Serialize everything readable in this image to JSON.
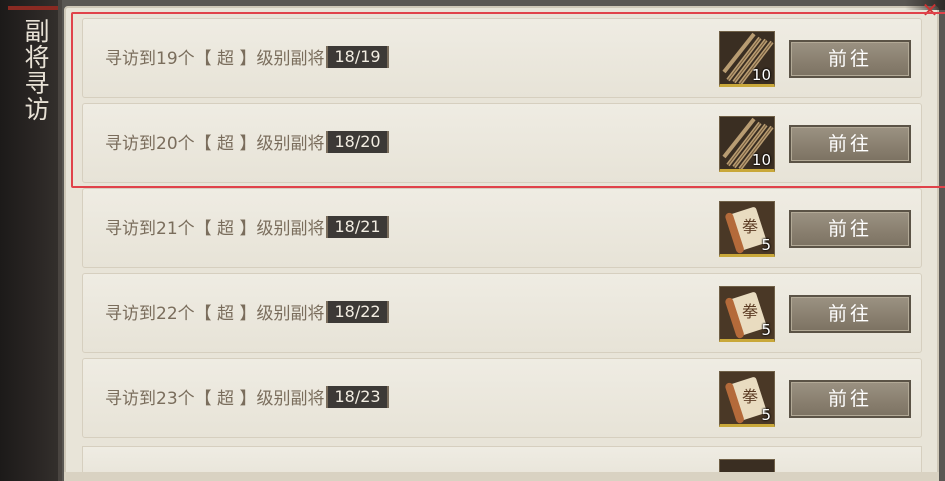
{
  "side_tab": {
    "title": "副将寻访"
  },
  "rows": [
    {
      "text": "寻访到19个【 超 】级别副将",
      "progress": "18/19",
      "reward_type": "bamboo-slips-icon",
      "reward_count": "10",
      "button": "前往"
    },
    {
      "text": "寻访到20个【 超 】级别副将",
      "progress": "18/20",
      "reward_type": "bamboo-slips-icon",
      "reward_count": "10",
      "button": "前往"
    },
    {
      "text": "寻访到21个【 超 】级别副将",
      "progress": "18/21",
      "reward_type": "scroll-icon",
      "reward_count": "5",
      "button": "前往"
    },
    {
      "text": "寻访到22个【 超 】级别副将",
      "progress": "18/22",
      "reward_type": "scroll-icon",
      "reward_count": "5",
      "button": "前往"
    },
    {
      "text": "寻访到23个【 超 】级别副将",
      "progress": "18/23",
      "reward_type": "scroll-icon",
      "reward_count": "5",
      "button": "前往"
    }
  ],
  "colors": {
    "highlight": "#e0424a",
    "reward_border": "#c9a83a",
    "button": "#8a8070"
  }
}
